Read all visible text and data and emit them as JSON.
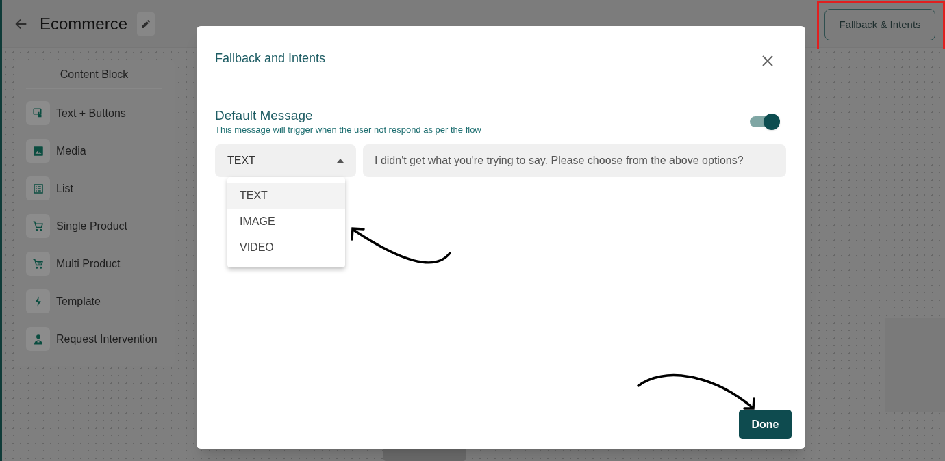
{
  "header": {
    "title": "Ecommerce",
    "fallback_button": "Fallback & Intents"
  },
  "sidebar": {
    "title": "Content Block",
    "items": [
      {
        "label": "Text + Buttons"
      },
      {
        "label": "Media"
      },
      {
        "label": "List"
      },
      {
        "label": "Single Product"
      },
      {
        "label": "Multi Product"
      },
      {
        "label": "Template"
      },
      {
        "label": "Request Intervention"
      }
    ]
  },
  "modal": {
    "title": "Fallback and Intents",
    "section_title": "Default Message",
    "description": "This message will trigger when the user not respond as per the flow",
    "enabled": true,
    "type_select": {
      "value": "TEXT",
      "expanded": true,
      "options": [
        {
          "label": "TEXT",
          "selected": true
        },
        {
          "label": "IMAGE",
          "selected": false
        },
        {
          "label": "VIDEO",
          "selected": false
        }
      ]
    },
    "message": "I didn't get what you're trying to say. Please choose from the above options?",
    "done_button": "Done"
  }
}
